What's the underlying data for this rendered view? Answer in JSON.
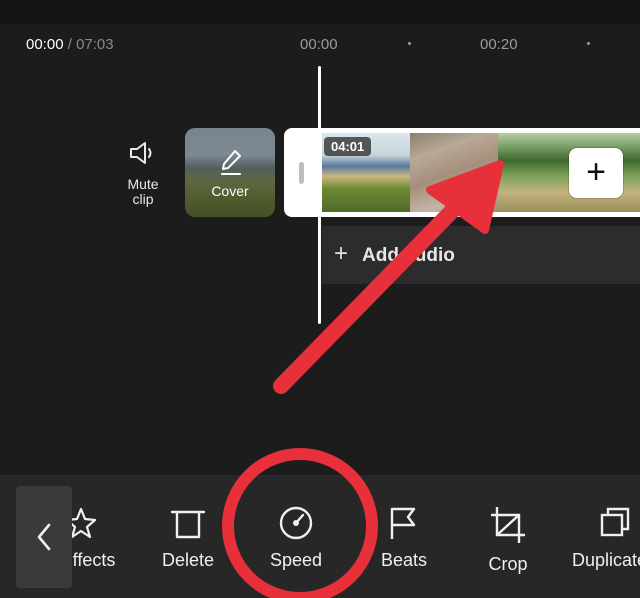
{
  "timeline": {
    "current_time": "00:00",
    "separator": "/",
    "total_time": "07:03",
    "ruler_labels": [
      "00:00",
      "00:20"
    ]
  },
  "track": {
    "mute_label_line1": "Mute",
    "mute_label_line2": "clip",
    "cover_label": "Cover",
    "clip_duration": "04:01",
    "add_clip_symbol": "+",
    "add_audio_symbol": "+",
    "add_audio_label": "Add audio"
  },
  "toolbar": {
    "back_icon": "chevron-left-icon",
    "items": [
      {
        "label": "Effects",
        "icon": "effects-icon"
      },
      {
        "label": "Delete",
        "icon": "trash-icon"
      },
      {
        "label": "Speed",
        "icon": "speed-icon"
      },
      {
        "label": "Beats",
        "icon": "flag-icon"
      },
      {
        "label": "Crop",
        "icon": "crop-icon"
      },
      {
        "label": "Duplicate",
        "icon": "duplicate-icon"
      }
    ]
  },
  "colors": {
    "background": "#1c1c1c",
    "toolbar": "#272727",
    "annotation_red": "#e8303a",
    "playhead": "#ffffff"
  }
}
